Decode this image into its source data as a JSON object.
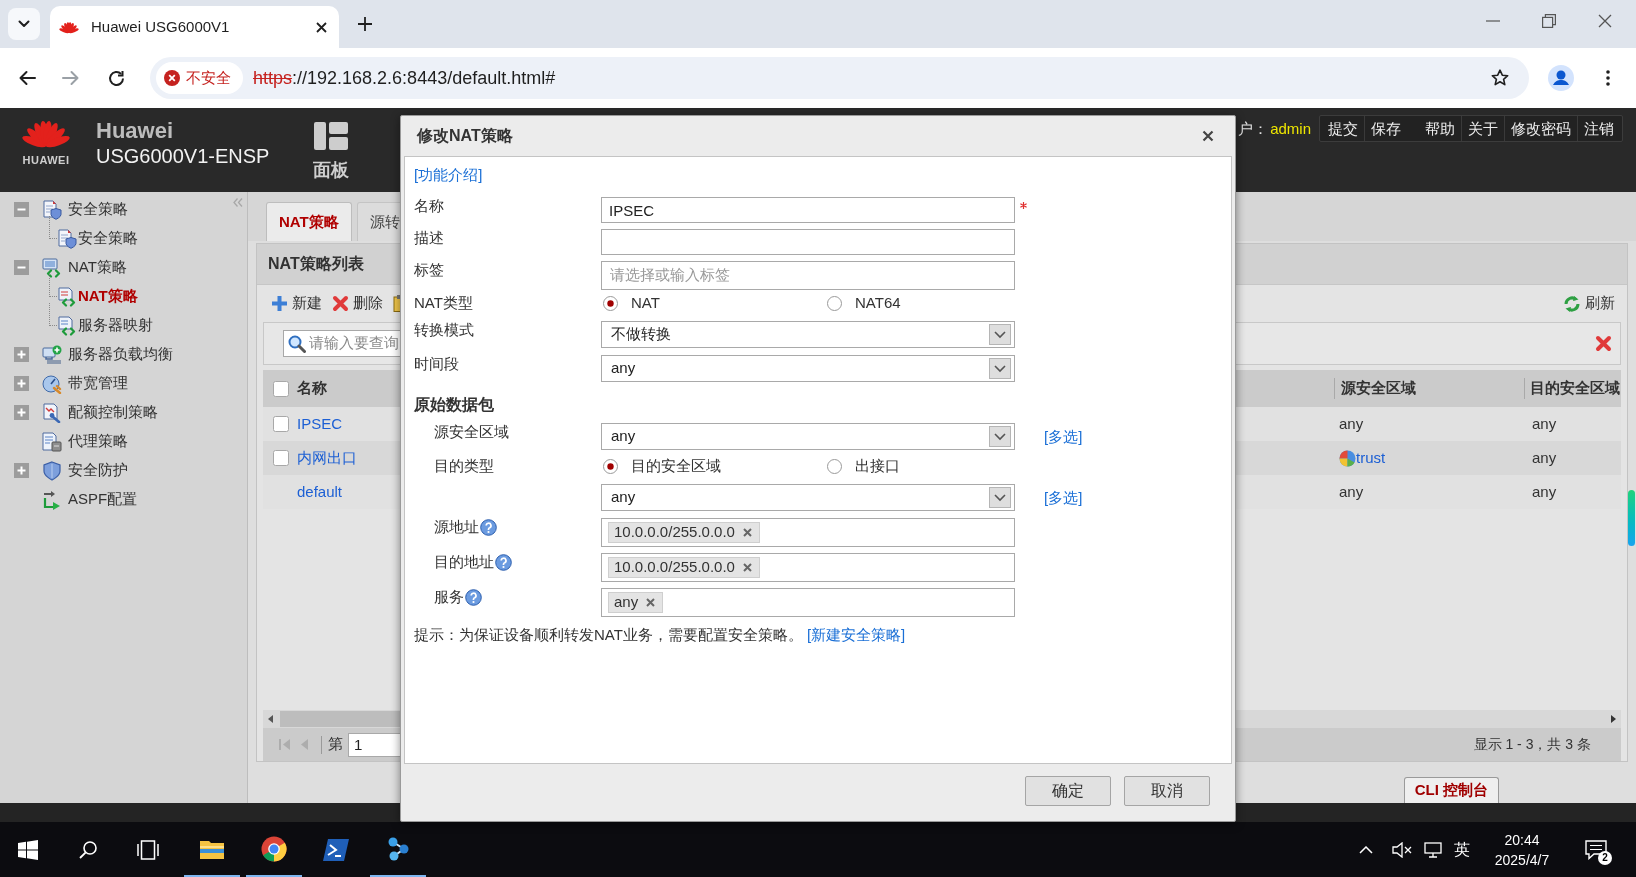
{
  "browser": {
    "tabs": [
      {
        "title": "Huawei USG6000V1",
        "selected": true
      }
    ],
    "security_label": "不安全",
    "url_scheme": "https",
    "url_rest": "://192.168.2.6:8443/default.html#"
  },
  "header": {
    "logo_text": "HUAWEI",
    "brand": "Huawei",
    "model": "USG6000V1-ENSP",
    "panel_label": "面板",
    "user_label": "户：",
    "user_name": "admin",
    "action_groups": [
      {
        "items": [
          "提交",
          "保存"
        ]
      },
      {
        "items": [
          "帮助",
          "关于",
          "修改密码",
          "注销"
        ]
      }
    ]
  },
  "sidebar": {
    "items": [
      {
        "label": "安全策略",
        "kind": "group",
        "expanded": true,
        "selected": false,
        "children": [
          {
            "label": "安全策略",
            "selected": false
          }
        ]
      },
      {
        "label": "NAT策略",
        "kind": "group",
        "expanded": true,
        "selected": false,
        "children": [
          {
            "label": "NAT策略",
            "selected": true
          },
          {
            "label": "服务器映射",
            "selected": false
          }
        ]
      },
      {
        "label": "服务器负载均衡",
        "kind": "group",
        "expanded": false,
        "selected": false
      },
      {
        "label": "带宽管理",
        "kind": "group",
        "expanded": false,
        "selected": false
      },
      {
        "label": "配额控制策略",
        "kind": "group",
        "expanded": false,
        "selected": false
      },
      {
        "label": "代理策略",
        "kind": "leaf",
        "selected": false
      },
      {
        "label": "安全防护",
        "kind": "group",
        "expanded": false,
        "selected": false
      },
      {
        "label": "ASPF配置",
        "kind": "leaf",
        "selected": false
      }
    ]
  },
  "content_tabs": [
    {
      "label": "NAT策略",
      "selected": true
    },
    {
      "label": "源转",
      "selected": false
    }
  ],
  "panel": {
    "title": "NAT策略列表",
    "toolbar": [
      "新建",
      "删除"
    ],
    "refresh_label": "刷新",
    "search": {
      "placeholder": "请输入要查询"
    },
    "table": {
      "select_all": {
        "checked": false
      },
      "columns": [
        "名称",
        "源安全区域",
        "目的安全区域"
      ],
      "rows": [
        {
          "kind": "custom",
          "checked": false,
          "name": "IPSEC",
          "source_zone": {
            "kind": "plain",
            "text": "any"
          },
          "destination_zone": "any"
        },
        {
          "kind": "custom",
          "checked": false,
          "name": "内网出口",
          "source_zone": {
            "kind": "zone",
            "text": "trust"
          },
          "destination_zone": "any"
        },
        {
          "kind": "default",
          "name": "default",
          "source_zone": {
            "kind": "plain",
            "text": "any"
          },
          "destination_zone": "any"
        }
      ]
    },
    "pager": {
      "page_label": "第",
      "page": "1",
      "summary": "显示 1 - 3，共 3 条"
    }
  },
  "cli_button": "CLI 控制台",
  "dialog": {
    "title": "修改NAT策略",
    "help_link": "[功能介绍]",
    "fields": [
      {
        "kind": "text",
        "label": "名称",
        "value": "IPSEC",
        "required": true
      },
      {
        "kind": "text",
        "label": "描述",
        "required": false
      },
      {
        "kind": "tags",
        "label": "标签",
        "placeholder": "请选择或输入标签",
        "required": false
      },
      {
        "kind": "radio",
        "label": "NAT类型",
        "required": false,
        "options": [
          {
            "label": "NAT",
            "selected": true
          },
          {
            "label": "NAT64",
            "selected": false
          }
        ]
      },
      {
        "kind": "select",
        "label": "转换模式",
        "value": "不做转换",
        "required": false
      },
      {
        "kind": "select",
        "label": "时间段",
        "value": "any",
        "required": false
      },
      {
        "kind": "section",
        "label": "原始数据包",
        "fields": [
          {
            "kind": "select",
            "label": "源安全区域",
            "value": "any",
            "link": "[多选]",
            "help": false
          },
          {
            "kind": "radio",
            "label": "目的类型",
            "help": false,
            "options": [
              {
                "label": "目的安全区域",
                "selected": true
              },
              {
                "label": "出接口",
                "selected": false
              }
            ]
          },
          {
            "kind": "select",
            "value": "any",
            "link": "[多选]",
            "help": false
          },
          {
            "kind": "tags",
            "label": "源地址",
            "help": true,
            "tags": [
              "10.0.0.0/255.0.0.0"
            ]
          },
          {
            "kind": "tags",
            "label": "目的地址",
            "help": true,
            "tags": [
              "10.0.0.0/255.0.0.0"
            ]
          },
          {
            "kind": "tags",
            "label": "服务",
            "help": true,
            "tags": [
              "any"
            ]
          }
        ]
      }
    ],
    "hint": {
      "text": "提示：为保证设备顺利转发NAT业务，需要配置安全策略。",
      "link": "[新建安全策略]"
    },
    "buttons": [
      "确定",
      "取消"
    ]
  },
  "taskbar": {
    "apps": [
      {
        "running": true
      },
      {
        "running": true
      },
      {
        "running": false
      },
      {
        "running": true
      }
    ],
    "input_method": "英",
    "time": "20:44",
    "date": "2025/4/7",
    "notification_count": "2"
  }
}
